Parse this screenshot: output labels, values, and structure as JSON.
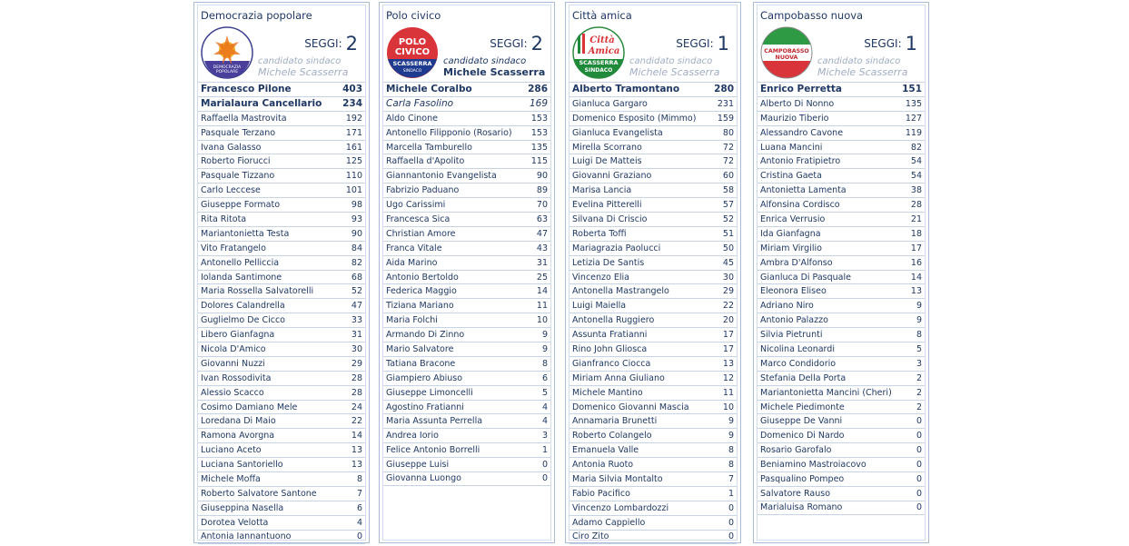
{
  "seggi_label": "SEGGI:",
  "candidato_label": "candidato sindaco",
  "candidato_name": "Michele Scasserra",
  "lists": [
    {
      "title": "Democrazia popolare",
      "seggi": "2",
      "logo_text": [
        "DEMOCRAZIA",
        "POPOLARE"
      ],
      "rows": [
        {
          "name": "Francesco Pilone",
          "votes": "403"
        },
        {
          "name": "Marialaura Cancellario",
          "votes": "234"
        },
        {
          "name": "Raffaella Mastrovita",
          "votes": "192"
        },
        {
          "name": "Pasquale Terzano",
          "votes": "171"
        },
        {
          "name": "Ivana Galasso",
          "votes": "161"
        },
        {
          "name": "Roberto Fiorucci",
          "votes": "125"
        },
        {
          "name": "Pasquale Tizzano",
          "votes": "110"
        },
        {
          "name": "Carlo Leccese",
          "votes": "101"
        },
        {
          "name": "Giuseppe Formato",
          "votes": "98"
        },
        {
          "name": "Rita Ritota",
          "votes": "93"
        },
        {
          "name": "Mariantonietta Testa",
          "votes": "90"
        },
        {
          "name": "Vito Fratangelo",
          "votes": "84"
        },
        {
          "name": "Antonello Pelliccia",
          "votes": "82"
        },
        {
          "name": "Iolanda Santimone",
          "votes": "68"
        },
        {
          "name": "Maria Rossella Salvatorelli",
          "votes": "52"
        },
        {
          "name": "Dolores Calandrella",
          "votes": "47"
        },
        {
          "name": "Guglielmo De Cicco",
          "votes": "33"
        },
        {
          "name": "Libero Gianfagna",
          "votes": "31"
        },
        {
          "name": "Nicola D'Amico",
          "votes": "30"
        },
        {
          "name": "Giovanni Nuzzi",
          "votes": "29"
        },
        {
          "name": "Ivan Rossodivita",
          "votes": "28"
        },
        {
          "name": "Alessio Scacco",
          "votes": "28"
        },
        {
          "name": "Cosimo Damiano Mele",
          "votes": "24"
        },
        {
          "name": "Loredana Di Maio",
          "votes": "22"
        },
        {
          "name": "Ramona Avorgna",
          "votes": "14"
        },
        {
          "name": "Luciano Aceto",
          "votes": "13"
        },
        {
          "name": "Luciana Santoriello",
          "votes": "13"
        },
        {
          "name": "Michele Moffa",
          "votes": "8"
        },
        {
          "name": "Roberto Salvatore Santone",
          "votes": "7"
        },
        {
          "name": "Giuseppina Nasella",
          "votes": "6"
        },
        {
          "name": "Dorotea Velotta",
          "votes": "4"
        },
        {
          "name": "Antonia Iannantuono",
          "votes": "0"
        }
      ]
    },
    {
      "title": "Polo civico",
      "seggi": "2",
      "logo_text": [
        "POLO",
        "CIVICO",
        "SCASSERRA",
        "SINDACO"
      ],
      "rows": [
        {
          "name": "Michele Coralbo",
          "votes": "286"
        },
        {
          "name": "Carla Fasolino",
          "votes": "169"
        },
        {
          "name": "Aldo Cinone",
          "votes": "153"
        },
        {
          "name": "Antonello Filipponio (Rosario)",
          "votes": "153"
        },
        {
          "name": "Marcella Tamburello",
          "votes": "135"
        },
        {
          "name": "Raffaella d'Apolito",
          "votes": "115"
        },
        {
          "name": "Giannantonio Evangelista",
          "votes": "90"
        },
        {
          "name": "Fabrizio Paduano",
          "votes": "89"
        },
        {
          "name": "Ugo Carissimi",
          "votes": "70"
        },
        {
          "name": "Francesca Sica",
          "votes": "63"
        },
        {
          "name": "Christian Amore",
          "votes": "47"
        },
        {
          "name": "Franca Vitale",
          "votes": "43"
        },
        {
          "name": "Aida Marino",
          "votes": "31"
        },
        {
          "name": "Antonio Bertoldo",
          "votes": "25"
        },
        {
          "name": "Federica Maggio",
          "votes": "14"
        },
        {
          "name": "Tiziana Mariano",
          "votes": "11"
        },
        {
          "name": "Maria Folchi",
          "votes": "10"
        },
        {
          "name": "Armando Di Zinno",
          "votes": "9"
        },
        {
          "name": "Mario Salvatore",
          "votes": "9"
        },
        {
          "name": "Tatiana Bracone",
          "votes": "8"
        },
        {
          "name": "Giampiero Abiuso",
          "votes": "6"
        },
        {
          "name": "Giuseppe Limoncelli",
          "votes": "5"
        },
        {
          "name": "Agostino Fratianni",
          "votes": "4"
        },
        {
          "name": "Maria Assunta Perrella",
          "votes": "4"
        },
        {
          "name": "Andrea Iorio",
          "votes": "3"
        },
        {
          "name": "Felice Antonio Borrelli",
          "votes": "1"
        },
        {
          "name": "Giuseppe Luisi",
          "votes": "0"
        },
        {
          "name": "Giovanna Luongo",
          "votes": "0"
        }
      ]
    },
    {
      "title": "Città amica",
      "seggi": "1",
      "logo_text": [
        "Città",
        "Amica",
        "SCASSERRA",
        "SINDACO"
      ],
      "rows": [
        {
          "name": "Alberto Tramontano",
          "votes": "280"
        },
        {
          "name": "Gianluca Gargaro",
          "votes": "231"
        },
        {
          "name": "Domenico Esposito (Mimmo)",
          "votes": "159"
        },
        {
          "name": "Gianluca Evangelista",
          "votes": "80"
        },
        {
          "name": "Mirella Scorrano",
          "votes": "72"
        },
        {
          "name": "Luigi De Matteis",
          "votes": "72"
        },
        {
          "name": "Giovanni Graziano",
          "votes": "60"
        },
        {
          "name": "Marisa Lancia",
          "votes": "58"
        },
        {
          "name": "Evelina Pitterelli",
          "votes": "57"
        },
        {
          "name": "Silvana Di Criscio",
          "votes": "52"
        },
        {
          "name": "Roberta Toffi",
          "votes": "51"
        },
        {
          "name": "Mariagrazia Paolucci",
          "votes": "50"
        },
        {
          "name": "Letizia De Santis",
          "votes": "45"
        },
        {
          "name": "Vincenzo Elia",
          "votes": "30"
        },
        {
          "name": "Antonella Mastrangelo",
          "votes": "29"
        },
        {
          "name": "Luigi Maiella",
          "votes": "22"
        },
        {
          "name": "Antonella Ruggiero",
          "votes": "20"
        },
        {
          "name": "Assunta Fratianni",
          "votes": "17"
        },
        {
          "name": "Rino John Gliosca",
          "votes": "17"
        },
        {
          "name": "Gianfranco Ciocca",
          "votes": "13"
        },
        {
          "name": "Miriam Anna Giuliano",
          "votes": "12"
        },
        {
          "name": "Michele Mantino",
          "votes": "11"
        },
        {
          "name": "Domenico Giovanni Mascia",
          "votes": "10"
        },
        {
          "name": "Annamaria Brunetti",
          "votes": "9"
        },
        {
          "name": "Roberto Colangelo",
          "votes": "9"
        },
        {
          "name": "Emanuela Valle",
          "votes": "8"
        },
        {
          "name": "Antonia Ruoto",
          "votes": "8"
        },
        {
          "name": "Maria Silvia Montalto",
          "votes": "7"
        },
        {
          "name": "Fabio Pacifico",
          "votes": "1"
        },
        {
          "name": "Vincenzo Lombardozzi",
          "votes": "0"
        },
        {
          "name": "Adamo Cappiello",
          "votes": "0"
        },
        {
          "name": "Ciro Zito",
          "votes": "0"
        }
      ]
    },
    {
      "title": "Campobasso nuova",
      "seggi": "1",
      "logo_text": [
        "CAMPOBASSO",
        "NUOVA"
      ],
      "rows": [
        {
          "name": "Enrico Perretta",
          "votes": "151"
        },
        {
          "name": "Alberto Di Nonno",
          "votes": "135"
        },
        {
          "name": "Maurizio Tiberio",
          "votes": "127"
        },
        {
          "name": "Alessandro Cavone",
          "votes": "119"
        },
        {
          "name": "Luana Mancini",
          "votes": "82"
        },
        {
          "name": "Antonio Fratipietro",
          "votes": "54"
        },
        {
          "name": "Cristina Gaeta",
          "votes": "54"
        },
        {
          "name": "Antonietta Lamenta",
          "votes": "38"
        },
        {
          "name": "Alfonsina Cordisco",
          "votes": "28"
        },
        {
          "name": "Enrica Verrusio",
          "votes": "21"
        },
        {
          "name": "Ida Gianfagna",
          "votes": "18"
        },
        {
          "name": "Miriam Virgilio",
          "votes": "17"
        },
        {
          "name": "Ambra D'Alfonso",
          "votes": "16"
        },
        {
          "name": "Gianluca Di Pasquale",
          "votes": "14"
        },
        {
          "name": "Eleonora Eliseo",
          "votes": "13"
        },
        {
          "name": "Adriano Niro",
          "votes": "9"
        },
        {
          "name": "Antonio Palazzo",
          "votes": "9"
        },
        {
          "name": "Silvia Pietrunti",
          "votes": "8"
        },
        {
          "name": "Nicolina Leonardi",
          "votes": "5"
        },
        {
          "name": "Marco Condidorio",
          "votes": "3"
        },
        {
          "name": "Stefania Della Porta",
          "votes": "2"
        },
        {
          "name": "Mariantonietta Mancini (Cheri)",
          "votes": "2"
        },
        {
          "name": "Michele Piedimonte",
          "votes": "2"
        },
        {
          "name": "Giuseppe De Vanni",
          "votes": "0"
        },
        {
          "name": "Domenico Di Nardo",
          "votes": "0"
        },
        {
          "name": "Rosario Garofalo",
          "votes": "0"
        },
        {
          "name": "Beniamino Mastroiacovo",
          "votes": "0"
        },
        {
          "name": "Pasqualino Pompeo",
          "votes": "0"
        },
        {
          "name": "Salvatore Rauso",
          "votes": "0"
        },
        {
          "name": "Marialuisa Romano",
          "votes": "0"
        }
      ]
    }
  ]
}
